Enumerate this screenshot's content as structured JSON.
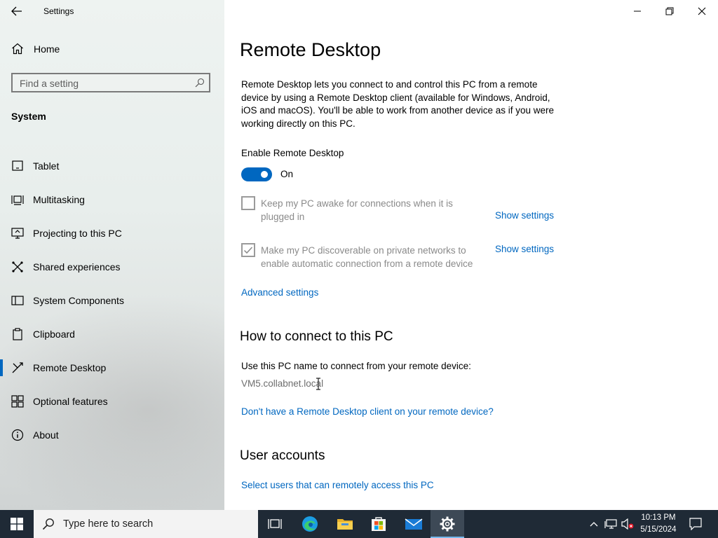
{
  "window": {
    "title": "Settings"
  },
  "nav": {
    "home_label": "Home",
    "search_placeholder": "Find a setting",
    "section_label": "System",
    "items": [
      {
        "label": "Tablet",
        "icon": "tablet-icon"
      },
      {
        "label": "Multitasking",
        "icon": "multitasking-icon"
      },
      {
        "label": "Projecting to this PC",
        "icon": "projecting-icon"
      },
      {
        "label": "Shared experiences",
        "icon": "shared-experiences-icon"
      },
      {
        "label": "System Components",
        "icon": "system-components-icon"
      },
      {
        "label": "Clipboard",
        "icon": "clipboard-icon"
      },
      {
        "label": "Remote Desktop",
        "icon": "remote-desktop-icon",
        "active": true
      },
      {
        "label": "Optional features",
        "icon": "optional-features-icon"
      },
      {
        "label": "About",
        "icon": "about-icon"
      }
    ]
  },
  "content": {
    "title": "Remote Desktop",
    "description": "Remote Desktop lets you connect to and control this PC from a remote device by using a Remote Desktop client (available for Windows, Android, iOS and macOS). You'll be able to work from another device as if you were working directly on this PC.",
    "enable_label": "Enable Remote Desktop",
    "toggle_state": "On",
    "toggle_on": true,
    "option1": {
      "line1": "Keep my PC awake for connections when it is",
      "line2": "plugged in",
      "checked": false,
      "link": "Show settings"
    },
    "option2": {
      "line1": "Make my PC discoverable on private networks to",
      "line2": "enable automatic connection from a remote device",
      "checked": true,
      "link": "Show settings"
    },
    "advanced_link": "Advanced settings",
    "connect_heading": "How to connect to this PC",
    "connect_label": "Use this PC name to connect from your remote device:",
    "pc_name": "VM5.collabnet.local",
    "client_link": "Don't have a Remote Desktop client on your remote device?",
    "accounts_heading": "User accounts",
    "accounts_link": "Select users that can remotely access this PC"
  },
  "taskbar": {
    "search_placeholder": "Type here to search",
    "apps": [
      "task-view-icon",
      "edge-icon",
      "file-explorer-icon",
      "store-icon",
      "mail-icon",
      "settings-icon"
    ],
    "time": "10:13 PM",
    "date": "5/15/2024"
  },
  "colors": {
    "accent": "#0067c0",
    "taskbar": "#1f2a36"
  }
}
